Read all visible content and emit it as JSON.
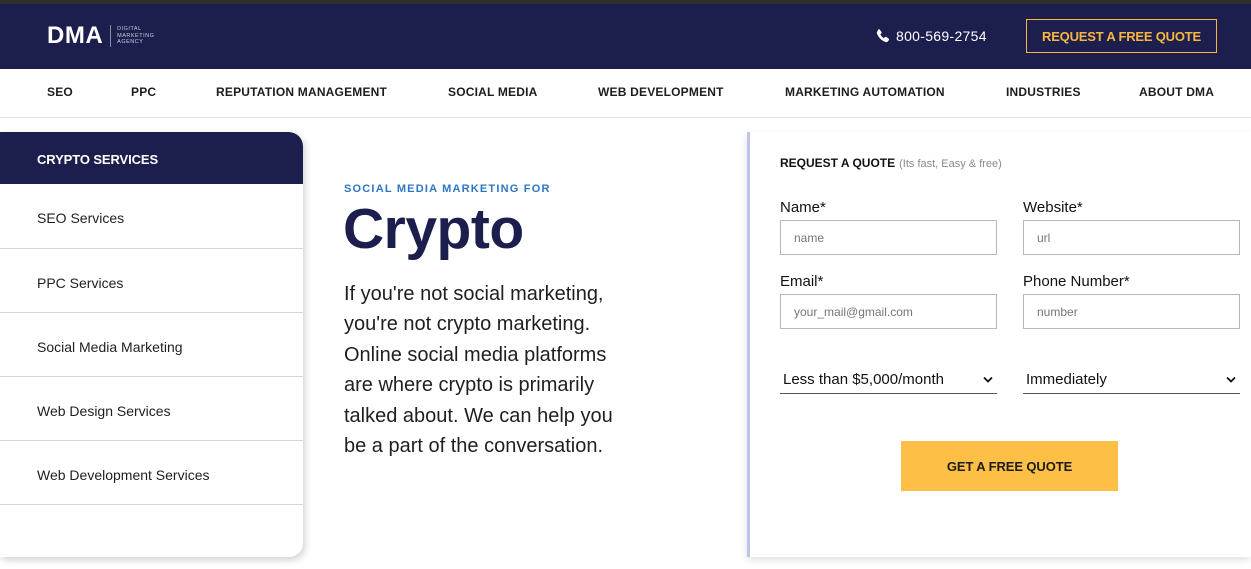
{
  "header": {
    "logo": "DMA",
    "logo_sub_line1": "DIGITAL",
    "logo_sub_line2": "MARKETING",
    "logo_sub_line3": "AGENCY",
    "phone": "800-569-2754",
    "quote_button": "REQUEST A FREE QUOTE"
  },
  "nav": {
    "items": [
      "SEO",
      "PPC",
      "REPUTATION MANAGEMENT",
      "SOCIAL MEDIA",
      "WEB DEVELOPMENT",
      "MARKETING AUTOMATION",
      "INDUSTRIES",
      "ABOUT DMA"
    ]
  },
  "sidebar": {
    "title": "CRYPTO SERVICES",
    "items": [
      "SEO Services",
      "PPC Services",
      "Social Media Marketing",
      "Web Design Services",
      "Web Development Services"
    ]
  },
  "hero": {
    "eyebrow": "SOCIAL MEDIA MARKETING FOR",
    "title": "Crypto",
    "text": "If you're not social marketing, you're not crypto marketing. Online social media platforms are where crypto is primarily talked about. We can help you be a part of the conversation."
  },
  "form": {
    "heading": "REQUEST A QUOTE",
    "subheading": "(Its fast, Easy & free)",
    "name_label": "Name*",
    "name_placeholder": "name",
    "website_label": "Website*",
    "website_placeholder": "url",
    "email_label": "Email*",
    "email_placeholder": "your_mail@gmail.com",
    "phone_label": "Phone Number*",
    "phone_placeholder": "number",
    "budget_selected": "Less than $5,000/month",
    "timeline_selected": "Immediately",
    "submit_label": "GET A FREE QUOTE"
  },
  "colors": {
    "navy": "#1c1f4e",
    "accent_gold": "#f9b63f",
    "button_gold": "#fdbf45",
    "eyebrow_blue": "#2d76c2"
  },
  "icons": {
    "phone": "phone-icon",
    "chevron": "chevron-down-icon"
  }
}
